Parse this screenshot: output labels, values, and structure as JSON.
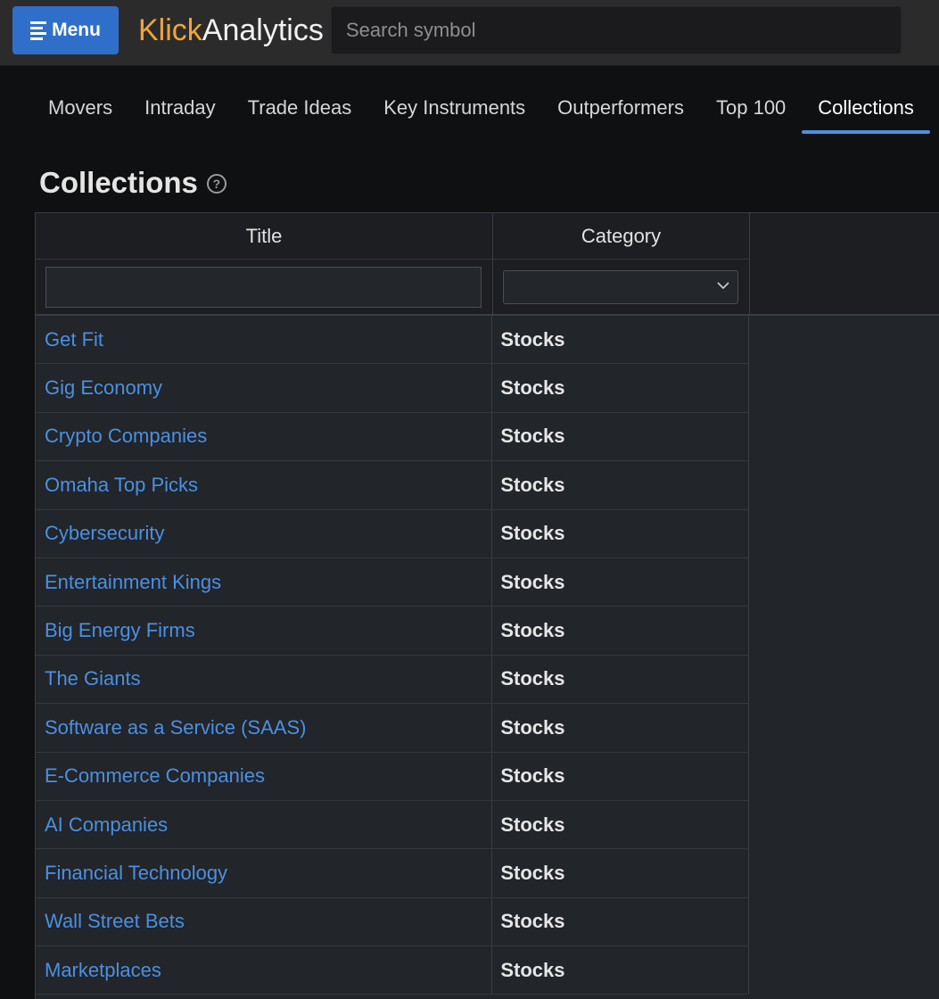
{
  "header": {
    "menu_label": "Menu",
    "logo_part1": "Klick",
    "logo_part2": "Analytics",
    "search_placeholder": "Search symbol"
  },
  "tabs": [
    {
      "label": "Movers",
      "active": false
    },
    {
      "label": "Intraday",
      "active": false
    },
    {
      "label": "Trade Ideas",
      "active": false
    },
    {
      "label": "Key Instruments",
      "active": false
    },
    {
      "label": "Outperformers",
      "active": false
    },
    {
      "label": "Top 100",
      "active": false
    },
    {
      "label": "Collections",
      "active": true
    }
  ],
  "page": {
    "title": "Collections",
    "help_icon": "help-circle-icon"
  },
  "table": {
    "columns": [
      "Title",
      "Category"
    ],
    "title_filter_value": "",
    "category_filter_value": "",
    "rows": [
      {
        "title": "Get Fit",
        "category": "Stocks"
      },
      {
        "title": "Gig Economy",
        "category": "Stocks"
      },
      {
        "title": "Crypto Companies",
        "category": "Stocks"
      },
      {
        "title": "Omaha Top Picks",
        "category": "Stocks"
      },
      {
        "title": "Cybersecurity",
        "category": "Stocks"
      },
      {
        "title": "Entertainment Kings",
        "category": "Stocks"
      },
      {
        "title": "Big Energy Firms",
        "category": "Stocks"
      },
      {
        "title": "The Giants",
        "category": "Stocks"
      },
      {
        "title": "Software as a Service (SAAS)",
        "category": "Stocks"
      },
      {
        "title": "E-Commerce Companies",
        "category": "Stocks"
      },
      {
        "title": "AI Companies",
        "category": "Stocks"
      },
      {
        "title": "Financial Technology",
        "category": "Stocks"
      },
      {
        "title": "Wall Street Bets",
        "category": "Stocks"
      },
      {
        "title": "Marketplaces",
        "category": "Stocks"
      }
    ]
  },
  "colors": {
    "accent": "#4a90e2",
    "menu_button": "#2f6fca",
    "logo_orange": "#f0a43a"
  }
}
